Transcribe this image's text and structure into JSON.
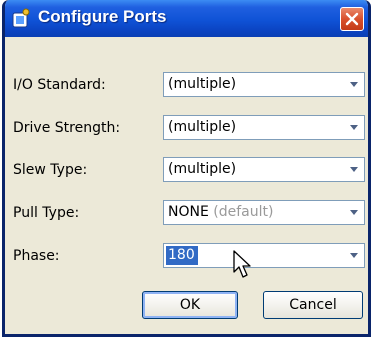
{
  "window": {
    "title": "Configure Ports"
  },
  "fields": [
    {
      "label": "I/O Standard:",
      "value": "(multiple)",
      "suffix": ""
    },
    {
      "label": "Drive Strength:",
      "value": "(multiple)",
      "suffix": ""
    },
    {
      "label": "Slew Type:",
      "value": "(multiple)",
      "suffix": ""
    },
    {
      "label": "Pull Type:",
      "value": "NONE",
      "suffix": " (default)"
    },
    {
      "label": "Phase:",
      "value": "180",
      "suffix": ""
    }
  ],
  "buttons": {
    "ok": "OK",
    "cancel": "Cancel"
  },
  "icons": {
    "title": "port-config-icon",
    "close": "close-icon",
    "dropdown": "chevron-down-icon",
    "cursor": "mouse-cursor-icon"
  },
  "colors": {
    "titlebar": "#0b45c4",
    "selection": "#316ac5",
    "close": "#d9502c",
    "dialog_bg": "#ece9d8"
  }
}
